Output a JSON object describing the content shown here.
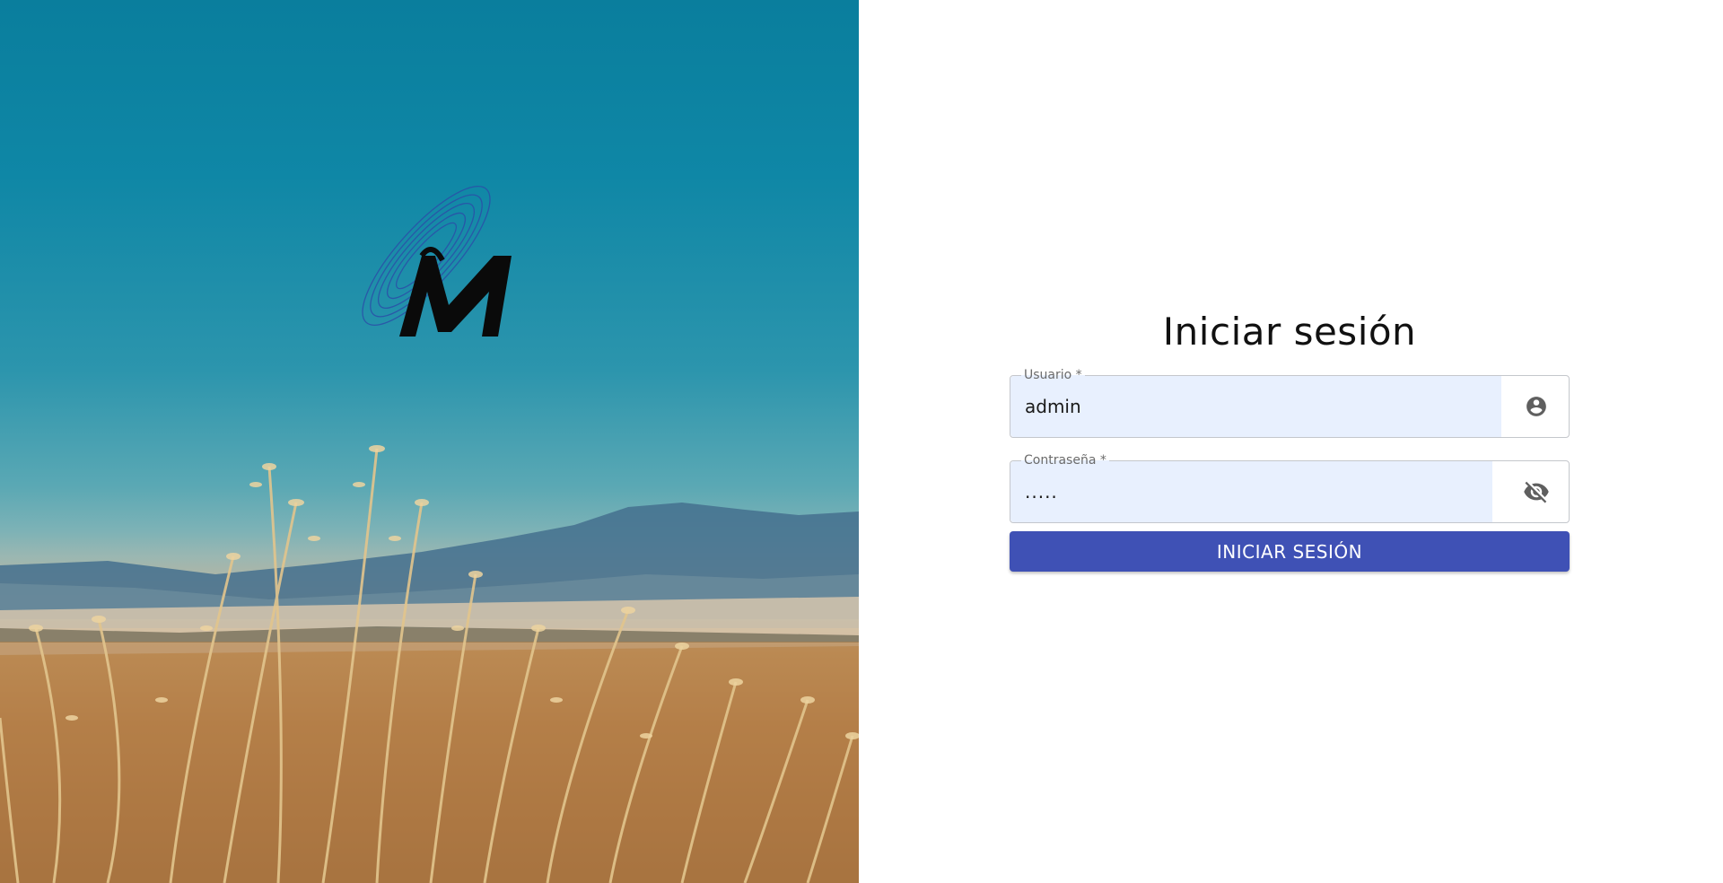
{
  "brand": {
    "logo_letter": "M"
  },
  "login": {
    "title": "Iniciar sesión",
    "username": {
      "label": "Usuario *",
      "value": "admin",
      "icon": "account-circle-icon"
    },
    "password": {
      "label": "Contraseña *",
      "value": ".....",
      "icon": "visibility-off-icon"
    },
    "submit_label": "INICIAR SESIÓN"
  },
  "colors": {
    "accent": "#3f51b5",
    "autofill": "#e8f0fe"
  }
}
